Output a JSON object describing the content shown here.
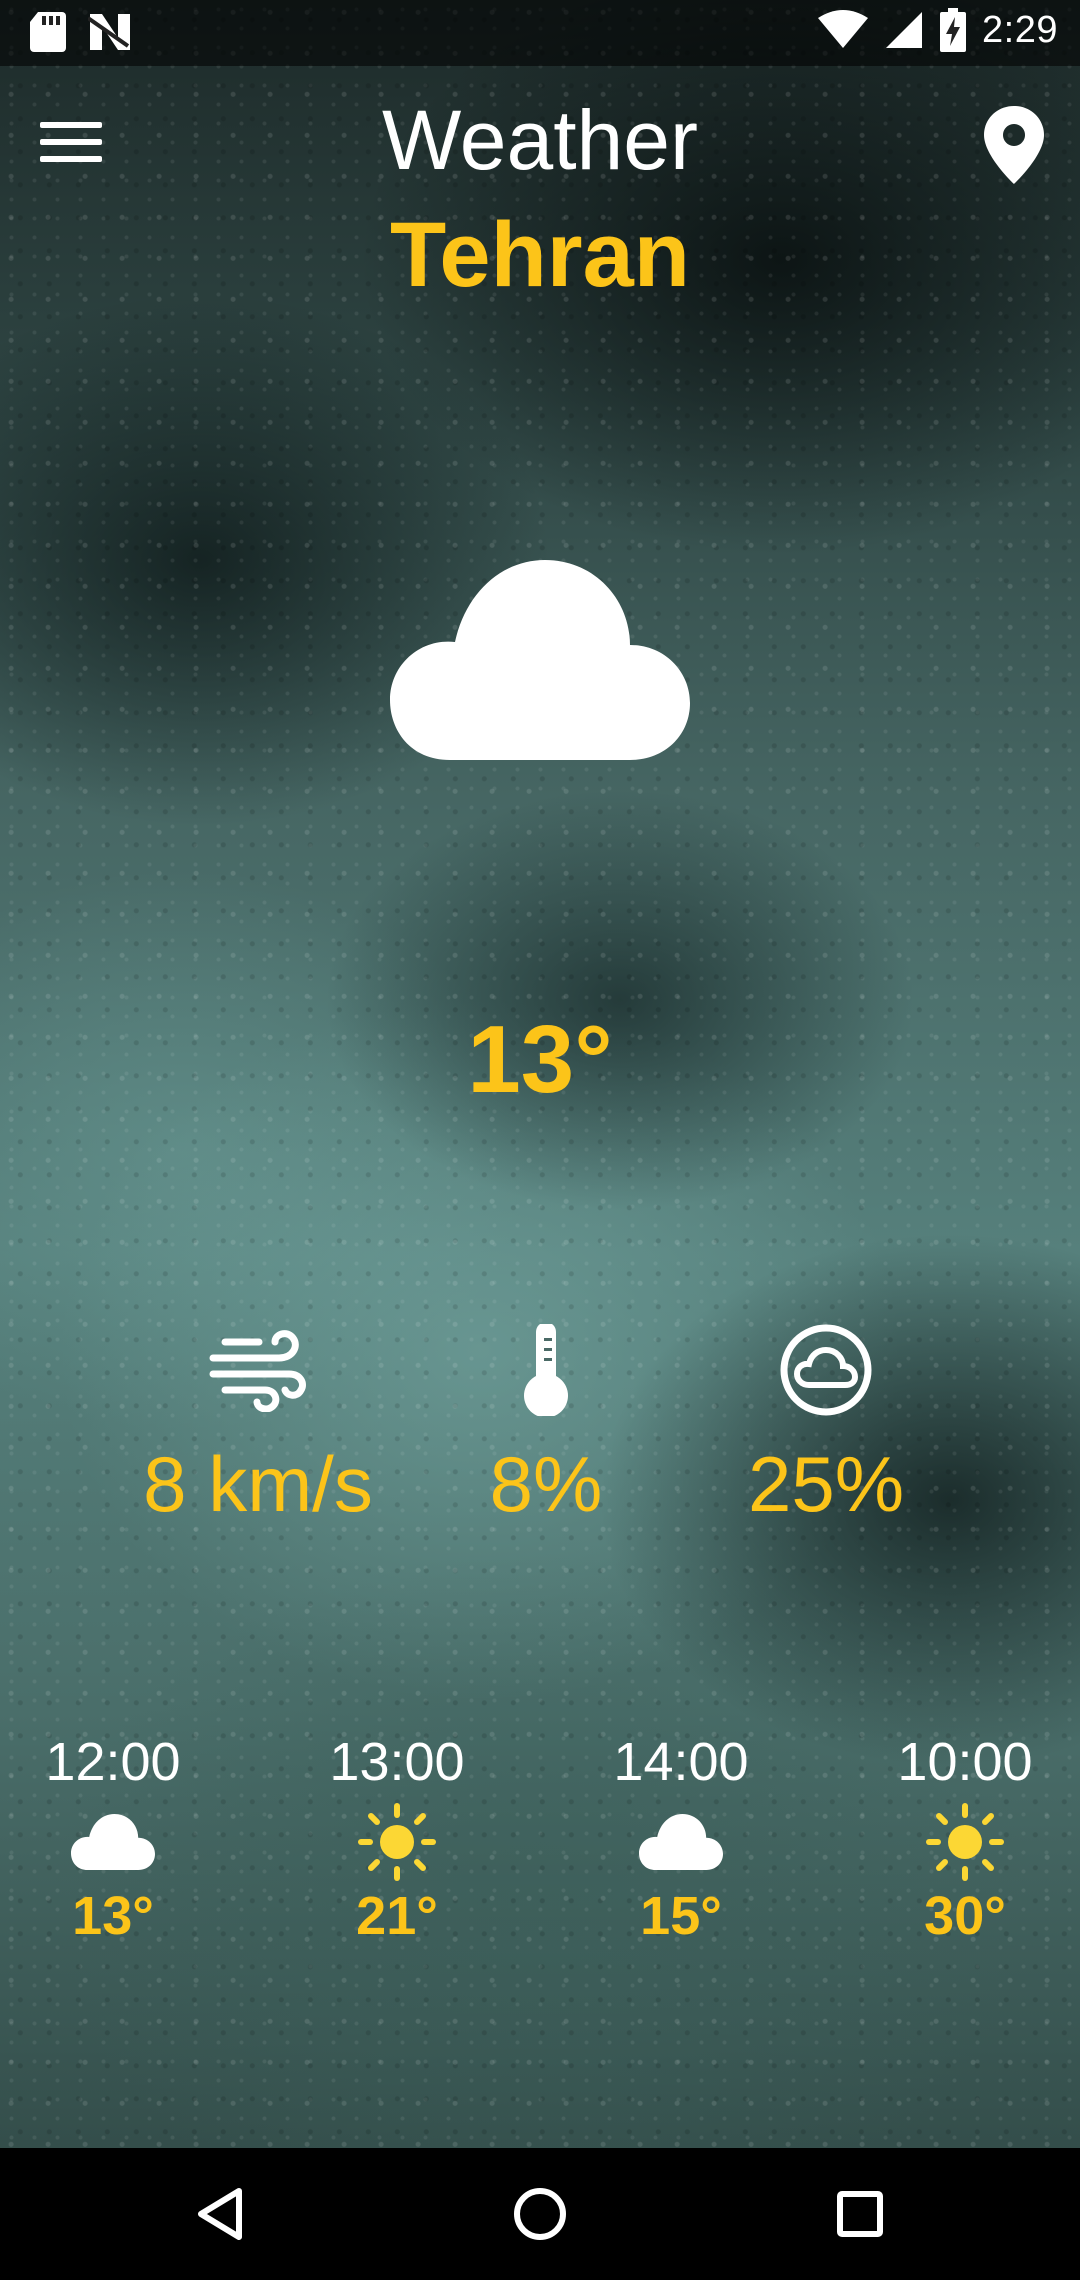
{
  "status_bar": {
    "time": "2:29",
    "icons": [
      "sd-card-icon",
      "n-icon",
      "wifi-icon",
      "signal-icon",
      "battery-charging-icon"
    ]
  },
  "header": {
    "title": "Weather",
    "city": "Tehran",
    "menu_icon": "hamburger-menu-icon",
    "location_icon": "location-pin-icon"
  },
  "current": {
    "condition_icon": "cloud-icon",
    "temperature": "13°"
  },
  "stats": [
    {
      "icon": "wind-icon",
      "value": "8 km/s"
    },
    {
      "icon": "thermometer-icon",
      "value": "8%"
    },
    {
      "icon": "cloud-circle-icon",
      "value": "25%"
    }
  ],
  "hourly": [
    {
      "time": "12:00",
      "icon": "cloud-icon",
      "temp": "13°"
    },
    {
      "time": "13:00",
      "icon": "sun-icon",
      "temp": "21°"
    },
    {
      "time": "14:00",
      "icon": "cloud-icon",
      "temp": "15°"
    },
    {
      "time": "10:00",
      "icon": "sun-icon",
      "temp": "30°"
    }
  ],
  "nav": [
    "back-icon",
    "home-icon",
    "recents-icon"
  ],
  "colors": {
    "accent": "#fcc419",
    "text": "#ffffff"
  }
}
